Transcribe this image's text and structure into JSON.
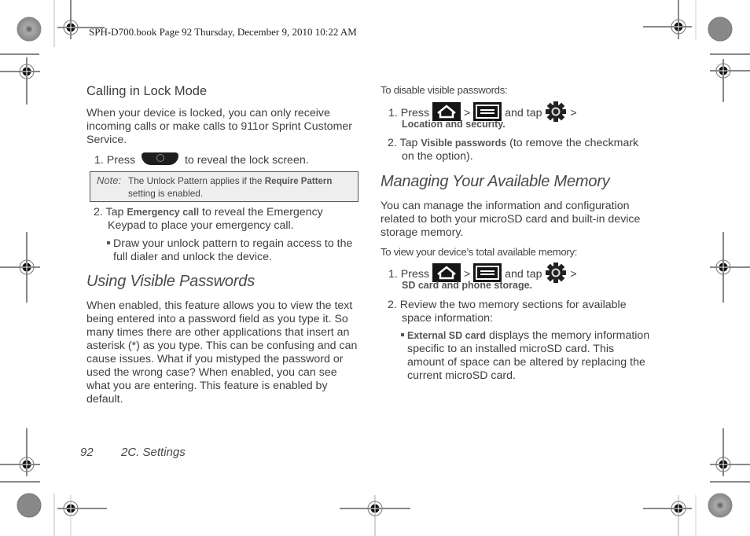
{
  "slug": "SPH-D700.book  Page 92  Thursday, December 9, 2010  10:22 AM",
  "left": {
    "calling_heading": "Calling in Lock Mode",
    "calling_intro": [
      "When your device is locked, you can only receive",
      "incoming calls or make calls to 911or Sprint Customer",
      "Service."
    ],
    "step1_prefix": "1. Press",
    "step1_suffix": "to reveal the lock screen.",
    "note": {
      "label": "Note:",
      "text_before": "The Unlock Pattern applies if the ",
      "text_bold": "Require Pattern",
      "text_after": "setting is enabled."
    },
    "step2_prefix": "2. Tap ",
    "step2_bold": "Emergency call",
    "step2_suffix": " to reveal the Emergency",
    "step2_line2": "Keypad to place your emergency call.",
    "bullet1_line1": "Draw your unlock pattern to regain access to the",
    "bullet1_line2": "full dialer and unlock the device.",
    "visible_heading": "Using Visible Passwords",
    "visible_body": [
      "When enabled, this feature allows you to view the text",
      "being entered into a password field as you type it. So",
      "many times there are other applications that insert an",
      "asterisk (*) as you type. This can be confusing and can",
      "cause issues. What if you mistyped the password or",
      "used the wrong case? When enabled, you can see",
      "what you are entering. This feature is enabled by",
      "default."
    ]
  },
  "right": {
    "disable_intro": "To disable visible passwords:",
    "d_step1_prefix": "1. Press",
    "gt": ">",
    "and_tap": "and tap",
    "d_step1_bold": "Location and security.",
    "d_step2_prefix": "2. Tap ",
    "d_step2_bold": "Visible passwords",
    "d_step2_suffix": " (to remove the checkmark",
    "d_step2_line2": "on the option).",
    "memory_heading": "Managing Your Available Memory",
    "memory_body": [
      "You can manage the information and configuration",
      "related to both your microSD card and built-in device",
      "storage memory."
    ],
    "view_intro": "To view your device’s total available memory:",
    "m_step1_prefix": "1. Press",
    "m_step1_bold": "SD card and phone storage.",
    "m_step2_line1": "2. Review the two memory sections for available",
    "m_step2_line2": "space information:",
    "m_bullet_bold": "External SD card",
    "m_bullet_line1": " displays the memory information",
    "m_bullet_line2": "specific to an installed microSD card. This",
    "m_bullet_line3": "amount of space can be altered by replacing the",
    "m_bullet_line4": "current microSD card."
  },
  "footer": {
    "page_number": "92",
    "section": "2C. Settings"
  },
  "icons": {
    "power_key": "power-key-icon",
    "home_key": "home-key-icon",
    "menu_key": "menu-key-icon",
    "settings": "settings-gear-icon"
  }
}
